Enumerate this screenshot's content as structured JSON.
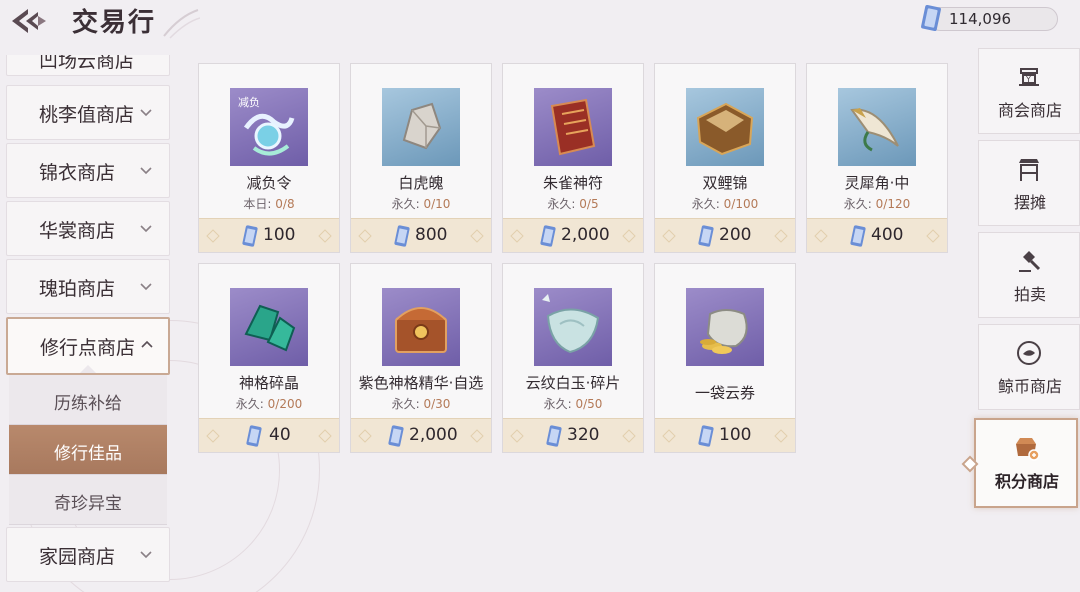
{
  "header": {
    "title": "交易行",
    "currency_value": "114,096"
  },
  "left_nav": {
    "partial_top": "凹场云商店",
    "items": [
      {
        "label": "桃李值商店"
      },
      {
        "label": "锦衣商店"
      },
      {
        "label": "华裳商店"
      },
      {
        "label": "瑰珀商店"
      },
      {
        "label": "修行点商店"
      }
    ],
    "sub_items": [
      {
        "label": "历练补给"
      },
      {
        "label": "修行佳品"
      },
      {
        "label": "奇珍异宝"
      }
    ],
    "bottom_item": {
      "label": "家园商店"
    }
  },
  "items": [
    {
      "name": "减负令",
      "limit_prefix": "本日:",
      "limit": "0/8",
      "price": "100",
      "icon": "scroll-token-icon",
      "badge": "减负"
    },
    {
      "name": "白虎魄",
      "limit_prefix": "永久:",
      "limit": "0/10",
      "price": "800",
      "icon": "crystal-rock-icon"
    },
    {
      "name": "朱雀神符",
      "limit_prefix": "永久:",
      "limit": "0/5",
      "price": "2,000",
      "icon": "red-talisman-icon"
    },
    {
      "name": "双鲤锦",
      "limit_prefix": "永久:",
      "limit": "0/100",
      "price": "200",
      "icon": "brocade-box-icon"
    },
    {
      "name": "灵犀角·中",
      "limit_prefix": "永久:",
      "limit": "0/120",
      "price": "400",
      "icon": "horn-icon"
    },
    {
      "name": "神格碎晶",
      "limit_prefix": "永久:",
      "limit": "0/200",
      "price": "40",
      "icon": "jade-shard-icon"
    },
    {
      "name": "紫色神格精华·自选",
      "limit_prefix": "永久:",
      "limit": "0/30",
      "price": "2,000",
      "icon": "treasure-chest-icon"
    },
    {
      "name": "云纹白玉·碎片",
      "limit_prefix": "永久:",
      "limit": "0/50",
      "price": "320",
      "icon": "white-jade-icon"
    },
    {
      "name": "一袋云券",
      "price": "100",
      "icon": "coin-bag-icon"
    }
  ],
  "right_nav": [
    {
      "label": "商会商店",
      "icon": "guild-icon"
    },
    {
      "label": "摆摊",
      "icon": "stall-icon"
    },
    {
      "label": "拍卖",
      "icon": "gavel-icon"
    },
    {
      "label": "鲸币商店",
      "icon": "whale-coin-icon"
    },
    {
      "label": "积分商店",
      "icon": "points-shop-icon"
    }
  ],
  "colors": {
    "accent": "#c9a48c",
    "active_sub": "#b8896c",
    "price_bg": "#f1e6d4",
    "limit_num": "#b47a58"
  }
}
